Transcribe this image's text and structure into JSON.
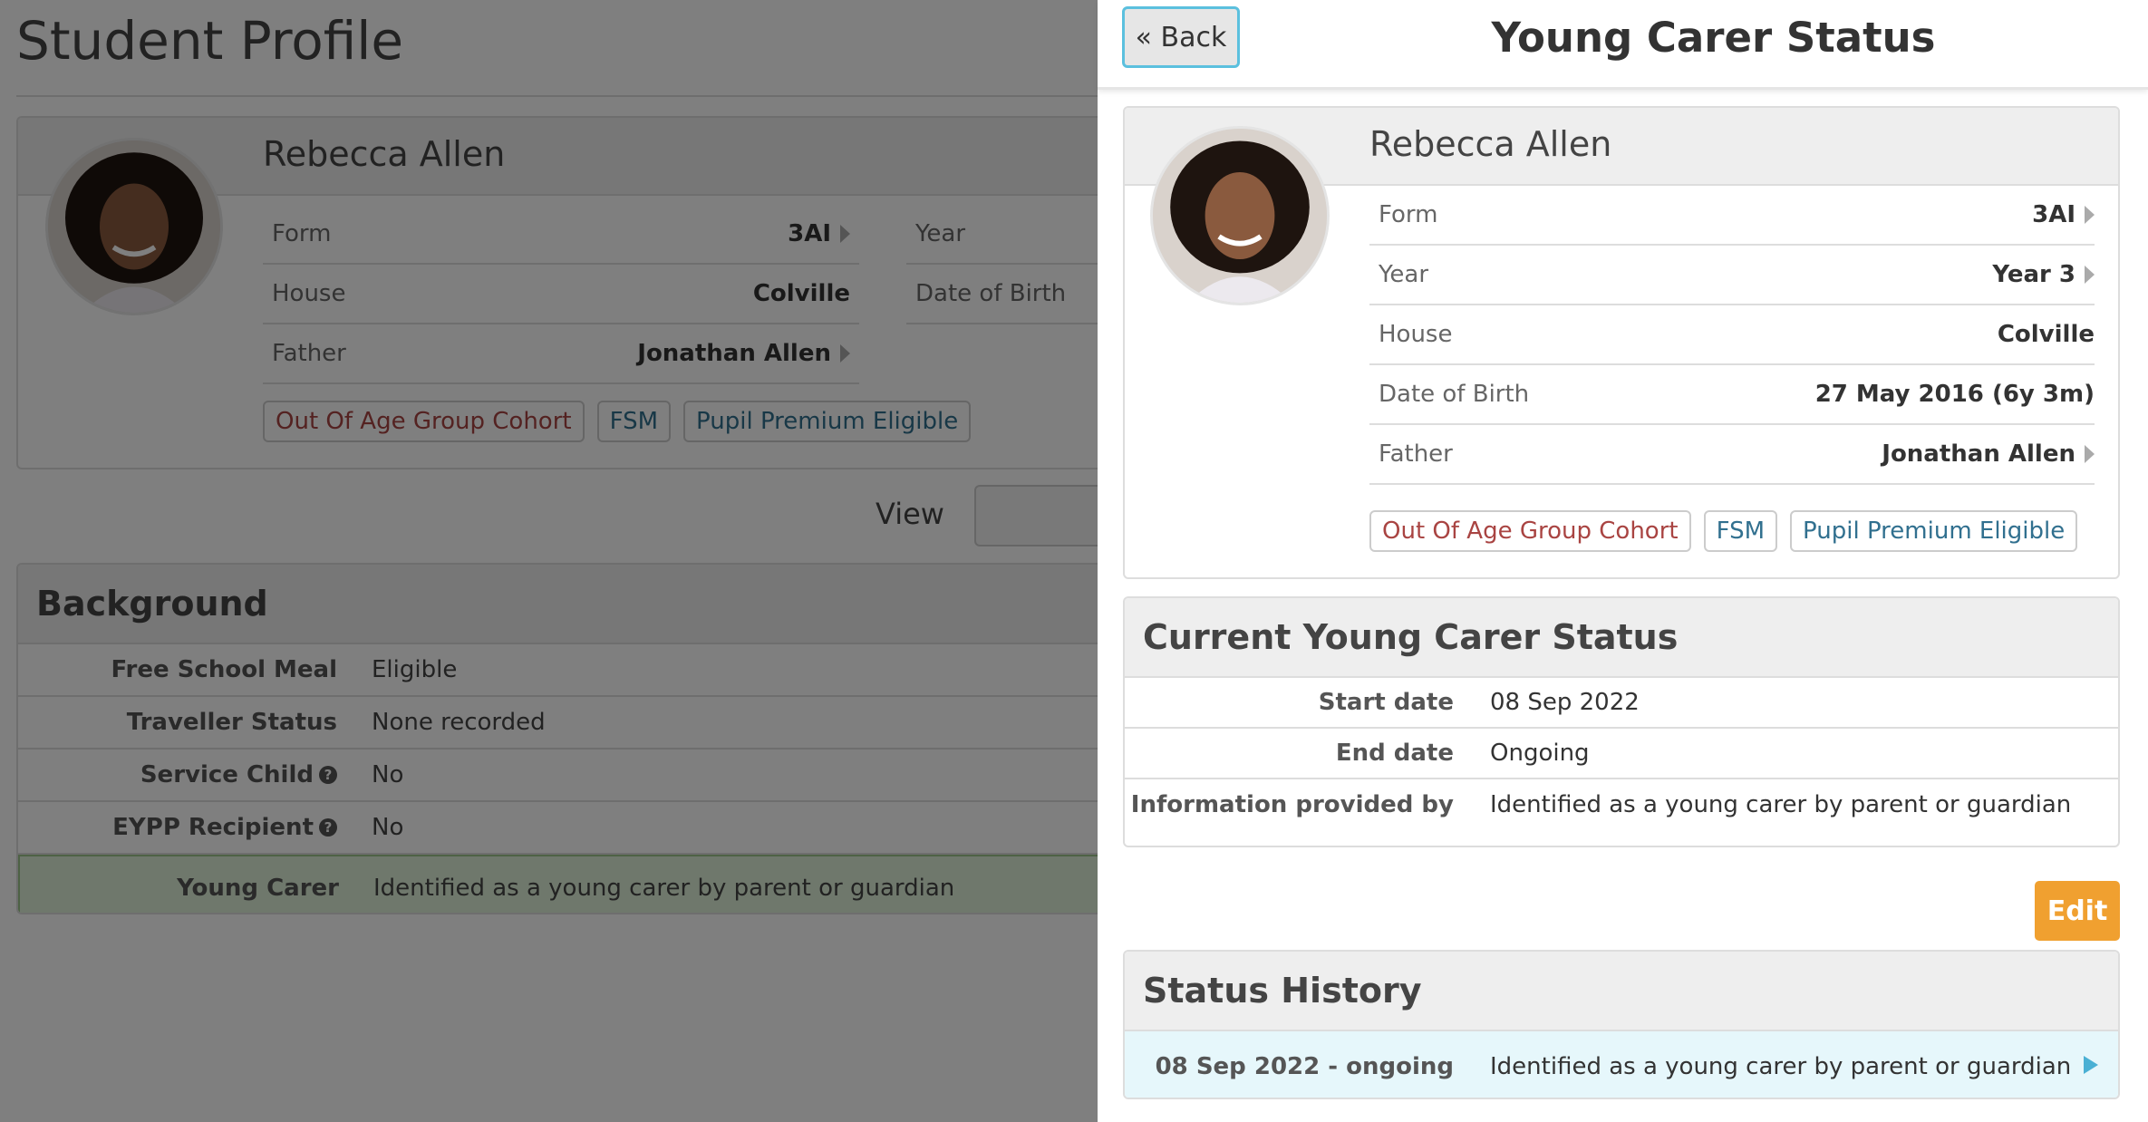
{
  "background_page": {
    "title": "Student Profile",
    "student_name": "Rebecca Allen",
    "fields_left": [
      {
        "label": "Form",
        "value": "3AI"
      },
      {
        "label": "House",
        "value": "Colville"
      },
      {
        "label": "Father",
        "value": "Jonathan Allen"
      }
    ],
    "fields_right": [
      {
        "label": "Year"
      },
      {
        "label": "Date of Birth"
      }
    ],
    "tags": [
      {
        "label": "Out Of Age Group Cohort",
        "color": "#a94442"
      },
      {
        "label": "FSM",
        "color": "#31708f"
      },
      {
        "label": "Pupil Premium Eligible",
        "color": "#31708f"
      }
    ],
    "view_label": "View",
    "background_section": {
      "title": "Background",
      "rows": [
        {
          "label": "Free School Meal",
          "value": "Eligible"
        },
        {
          "label": "Traveller Status",
          "value": "None recorded"
        },
        {
          "label": "Service Child",
          "value": "No"
        },
        {
          "label": "EYPP Recipient",
          "value": "No"
        },
        {
          "label": "Young Carer",
          "value": "Identified as a young carer by parent or guardian"
        }
      ],
      "help_glyph": "?"
    }
  },
  "panel": {
    "back_label": "« Back",
    "title": "Young Carer Status",
    "student": {
      "name": "Rebecca Allen",
      "fields": [
        {
          "label": "Form",
          "value": "3AI"
        },
        {
          "label": "Year",
          "value": "Year 3"
        },
        {
          "label": "House",
          "value": "Colville"
        },
        {
          "label": "Date of Birth",
          "value": "27 May 2016 (6y 3m)"
        },
        {
          "label": "Father",
          "value": "Jonathan Allen"
        }
      ],
      "tags": [
        {
          "label": "Out Of Age Group Cohort",
          "color": "#a94442"
        },
        {
          "label": "FSM",
          "color": "#31708f"
        },
        {
          "label": "Pupil Premium Eligible",
          "color": "#31708f"
        }
      ]
    },
    "current_status": {
      "title": "Current Young Carer Status",
      "rows": [
        {
          "label": "Start date",
          "value": "08 Sep 2022"
        },
        {
          "label": "End date",
          "value": "Ongoing"
        },
        {
          "label": "Information provided by",
          "value": "Identified as a young carer by parent or guardian"
        }
      ]
    },
    "edit_label": "Edit",
    "status_history": {
      "title": "Status History",
      "items": [
        {
          "period": "08 Sep 2022 - ongoing",
          "description": "Identified as a young carer by parent or guardian"
        }
      ]
    }
  },
  "colors": {
    "accent_blue": "#5bc0de",
    "edit_orange": "#f0a030",
    "highlight_row": "#e6f7fb",
    "young_carer_row": "#dff0d8"
  }
}
